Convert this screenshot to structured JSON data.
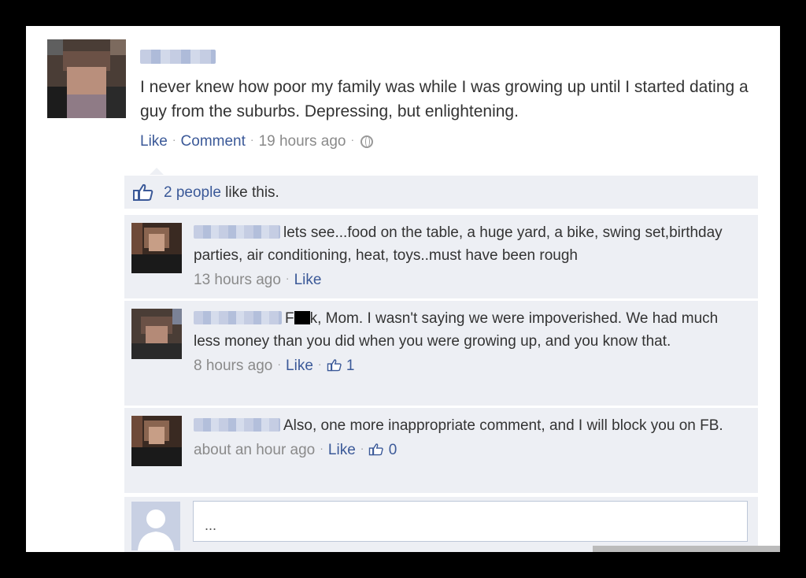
{
  "post": {
    "text": "I never knew how poor my family was while I was growing up until I started dating a guy from the suburbs. Depressing, but enlightening.",
    "like_label": "Like",
    "comment_label": "Comment",
    "timestamp": "19 hours ago",
    "privacy_icon": "globe-icon"
  },
  "likes": {
    "count_link": "2 people",
    "suffix": " like this.",
    "icon": "thumbs-up-icon"
  },
  "comments": [
    {
      "text": "lets see...food on the table, a huge yard, a bike, swing set,birthday parties, air conditioning, heat, toys..must have been rough",
      "timestamp": "13 hours ago",
      "like_label": "Like"
    },
    {
      "text_before": "F",
      "text_after": "k, Mom. I wasn't saying we were impoverished. We had much less money than you did when you were growing up, and you know that.",
      "timestamp": "8 hours ago",
      "like_label": "Like",
      "like_count": "1"
    },
    {
      "text": "Also, one more inappropriate comment, and I will block you on FB.",
      "timestamp": "about an hour ago",
      "like_label": "Like",
      "like_count": "0"
    }
  ],
  "reply": {
    "placeholder": "..."
  },
  "colors": {
    "link": "#3b5998",
    "comment_bg": "#edeff4",
    "meta": "#8a8a8a"
  }
}
